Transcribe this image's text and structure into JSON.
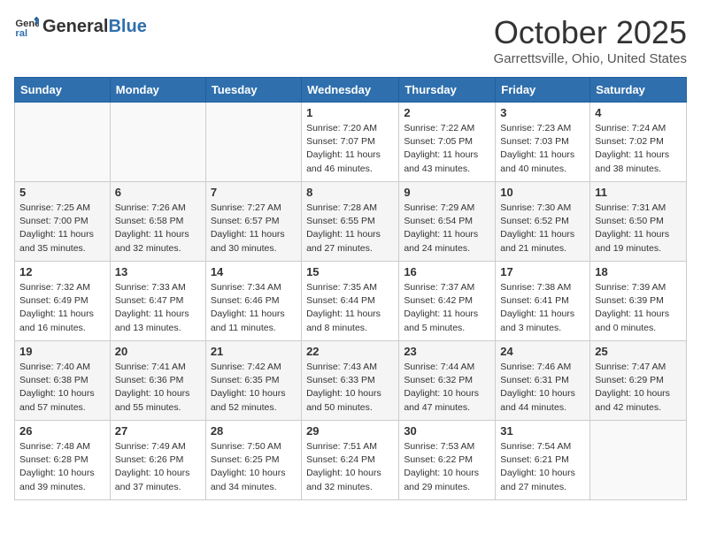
{
  "header": {
    "logo_general": "General",
    "logo_blue": "Blue",
    "month": "October 2025",
    "location": "Garrettsville, Ohio, United States"
  },
  "days_of_week": [
    "Sunday",
    "Monday",
    "Tuesday",
    "Wednesday",
    "Thursday",
    "Friday",
    "Saturday"
  ],
  "weeks": [
    [
      {
        "day": "",
        "info": ""
      },
      {
        "day": "",
        "info": ""
      },
      {
        "day": "",
        "info": ""
      },
      {
        "day": "1",
        "info": "Sunrise: 7:20 AM\nSunset: 7:07 PM\nDaylight: 11 hours and 46 minutes."
      },
      {
        "day": "2",
        "info": "Sunrise: 7:22 AM\nSunset: 7:05 PM\nDaylight: 11 hours and 43 minutes."
      },
      {
        "day": "3",
        "info": "Sunrise: 7:23 AM\nSunset: 7:03 PM\nDaylight: 11 hours and 40 minutes."
      },
      {
        "day": "4",
        "info": "Sunrise: 7:24 AM\nSunset: 7:02 PM\nDaylight: 11 hours and 38 minutes."
      }
    ],
    [
      {
        "day": "5",
        "info": "Sunrise: 7:25 AM\nSunset: 7:00 PM\nDaylight: 11 hours and 35 minutes."
      },
      {
        "day": "6",
        "info": "Sunrise: 7:26 AM\nSunset: 6:58 PM\nDaylight: 11 hours and 32 minutes."
      },
      {
        "day": "7",
        "info": "Sunrise: 7:27 AM\nSunset: 6:57 PM\nDaylight: 11 hours and 30 minutes."
      },
      {
        "day": "8",
        "info": "Sunrise: 7:28 AM\nSunset: 6:55 PM\nDaylight: 11 hours and 27 minutes."
      },
      {
        "day": "9",
        "info": "Sunrise: 7:29 AM\nSunset: 6:54 PM\nDaylight: 11 hours and 24 minutes."
      },
      {
        "day": "10",
        "info": "Sunrise: 7:30 AM\nSunset: 6:52 PM\nDaylight: 11 hours and 21 minutes."
      },
      {
        "day": "11",
        "info": "Sunrise: 7:31 AM\nSunset: 6:50 PM\nDaylight: 11 hours and 19 minutes."
      }
    ],
    [
      {
        "day": "12",
        "info": "Sunrise: 7:32 AM\nSunset: 6:49 PM\nDaylight: 11 hours and 16 minutes."
      },
      {
        "day": "13",
        "info": "Sunrise: 7:33 AM\nSunset: 6:47 PM\nDaylight: 11 hours and 13 minutes."
      },
      {
        "day": "14",
        "info": "Sunrise: 7:34 AM\nSunset: 6:46 PM\nDaylight: 11 hours and 11 minutes."
      },
      {
        "day": "15",
        "info": "Sunrise: 7:35 AM\nSunset: 6:44 PM\nDaylight: 11 hours and 8 minutes."
      },
      {
        "day": "16",
        "info": "Sunrise: 7:37 AM\nSunset: 6:42 PM\nDaylight: 11 hours and 5 minutes."
      },
      {
        "day": "17",
        "info": "Sunrise: 7:38 AM\nSunset: 6:41 PM\nDaylight: 11 hours and 3 minutes."
      },
      {
        "day": "18",
        "info": "Sunrise: 7:39 AM\nSunset: 6:39 PM\nDaylight: 11 hours and 0 minutes."
      }
    ],
    [
      {
        "day": "19",
        "info": "Sunrise: 7:40 AM\nSunset: 6:38 PM\nDaylight: 10 hours and 57 minutes."
      },
      {
        "day": "20",
        "info": "Sunrise: 7:41 AM\nSunset: 6:36 PM\nDaylight: 10 hours and 55 minutes."
      },
      {
        "day": "21",
        "info": "Sunrise: 7:42 AM\nSunset: 6:35 PM\nDaylight: 10 hours and 52 minutes."
      },
      {
        "day": "22",
        "info": "Sunrise: 7:43 AM\nSunset: 6:33 PM\nDaylight: 10 hours and 50 minutes."
      },
      {
        "day": "23",
        "info": "Sunrise: 7:44 AM\nSunset: 6:32 PM\nDaylight: 10 hours and 47 minutes."
      },
      {
        "day": "24",
        "info": "Sunrise: 7:46 AM\nSunset: 6:31 PM\nDaylight: 10 hours and 44 minutes."
      },
      {
        "day": "25",
        "info": "Sunrise: 7:47 AM\nSunset: 6:29 PM\nDaylight: 10 hours and 42 minutes."
      }
    ],
    [
      {
        "day": "26",
        "info": "Sunrise: 7:48 AM\nSunset: 6:28 PM\nDaylight: 10 hours and 39 minutes."
      },
      {
        "day": "27",
        "info": "Sunrise: 7:49 AM\nSunset: 6:26 PM\nDaylight: 10 hours and 37 minutes."
      },
      {
        "day": "28",
        "info": "Sunrise: 7:50 AM\nSunset: 6:25 PM\nDaylight: 10 hours and 34 minutes."
      },
      {
        "day": "29",
        "info": "Sunrise: 7:51 AM\nSunset: 6:24 PM\nDaylight: 10 hours and 32 minutes."
      },
      {
        "day": "30",
        "info": "Sunrise: 7:53 AM\nSunset: 6:22 PM\nDaylight: 10 hours and 29 minutes."
      },
      {
        "day": "31",
        "info": "Sunrise: 7:54 AM\nSunset: 6:21 PM\nDaylight: 10 hours and 27 minutes."
      },
      {
        "day": "",
        "info": ""
      }
    ]
  ]
}
